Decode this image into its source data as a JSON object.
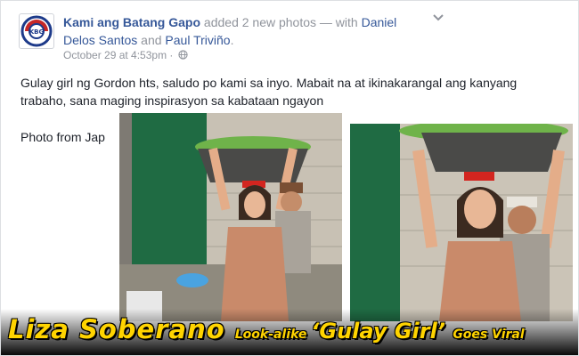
{
  "post": {
    "page_name": "Kami ang Batang Gapo",
    "action_text": " added 2 new photos — with ",
    "tag_1": "Daniel Delos Santos",
    "and_text": " and ",
    "tag_2": "Paul Triviño",
    "period": ".",
    "timestamp": "October 29 at 4:53pm",
    "dot": " · ",
    "body": "Gulay girl ng Gordon hts, saludo po kami sa inyo. Mabait na at ikinakarangal ang kanyang trabaho, sana maging inspirasyon sa kabataan ngayon",
    "credit": "Photo from Jap"
  },
  "banner": {
    "part1": "Liza Soberano ",
    "part2": "Look-alike ",
    "part3": "‘Gulay Girl’ ",
    "part4": "Goes Viral"
  },
  "icons": [
    "page-avatar-logo",
    "globe-icon",
    "chevron-down-icon"
  ],
  "colors": {
    "link": "#365899",
    "meta": "#90949c",
    "text": "#1d2129",
    "headline": "#ffd400"
  }
}
